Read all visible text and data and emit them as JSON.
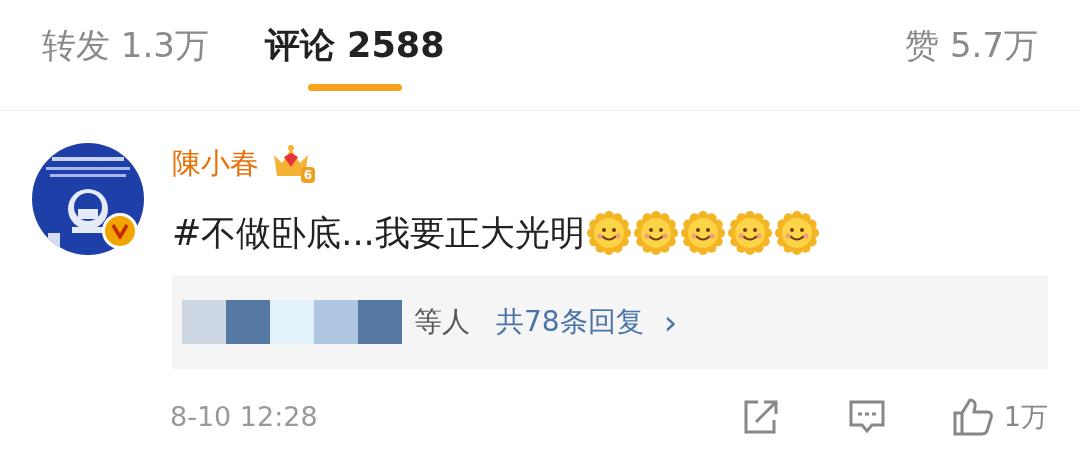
{
  "tabs": [
    {
      "label": "转发",
      "count": "1.3万",
      "selected": false
    },
    {
      "label": "评论",
      "count": "2588",
      "selected": true
    },
    {
      "label": "赞",
      "count": "5.7万",
      "selected": false
    }
  ],
  "comment": {
    "author": "陳小春",
    "verified": true,
    "level_badge": "6",
    "text": "#不做卧底...我要正大光明",
    "emojis": [
      {
        "kind": "smile"
      },
      {
        "kind": "smile"
      },
      {
        "kind": "smile"
      },
      {
        "kind": "smile"
      },
      {
        "kind": "smile"
      }
    ],
    "replies": {
      "suffix": "等人",
      "link": "共78条回复",
      "arrow": "›"
    },
    "time": "8-10 12:28",
    "likes": "1万"
  }
}
